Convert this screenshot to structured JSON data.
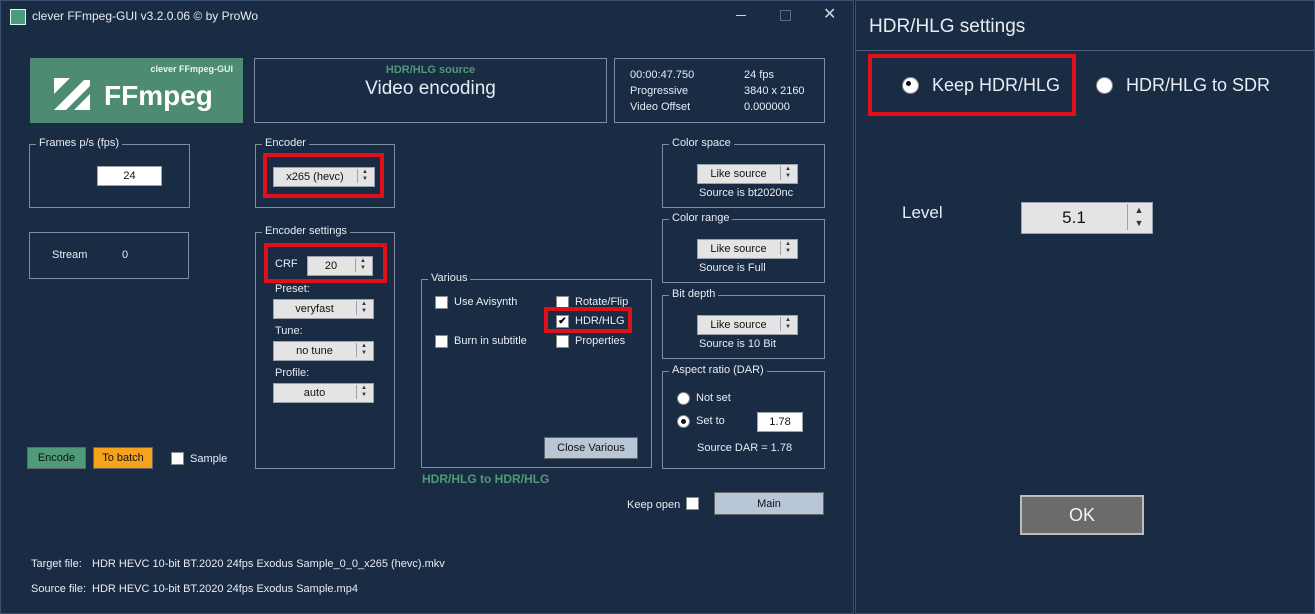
{
  "main_window": {
    "title": "clever FFmpeg-GUI v3.2.0.06   © by ProWo",
    "logo": {
      "small": "clever FFmpeg-GUI",
      "big": "FFmpeg"
    },
    "header": {
      "subtitle": "HDR/HLG source",
      "title": "Video encoding"
    },
    "info": {
      "duration": "00:00:47.750",
      "fps": "24 fps",
      "scan": "Progressive",
      "resolution": "3840 x 2160",
      "offset_label": "Video Offset",
      "offset_value": "0.000000"
    },
    "fps_box": {
      "legend": "Frames p/s (fps)",
      "value": "24"
    },
    "stream": {
      "label": "Stream",
      "value": "0"
    },
    "encoder": {
      "legend": "Encoder",
      "value": "x265 (hevc)"
    },
    "encoder_settings": {
      "legend": "Encoder settings",
      "crf_label": "CRF",
      "crf_value": "20",
      "preset_label": "Preset:",
      "preset_value": "veryfast",
      "tune_label": "Tune:",
      "tune_value": "no tune",
      "profile_label": "Profile:",
      "profile_value": "auto"
    },
    "various": {
      "legend": "Various",
      "use_avisynth": "Use Avisynth",
      "burn_subtitle": "Burn in subtitle",
      "rotate_flip": "Rotate/Flip",
      "hdr_hlg": "HDR/HLG",
      "properties": "Properties",
      "close_button": "Close Various"
    },
    "hdr_mode_text": "HDR/HLG to HDR/HLG",
    "color_space": {
      "legend": "Color space",
      "value": "Like source",
      "note": "Source is bt2020nc"
    },
    "color_range": {
      "legend": "Color range",
      "value": "Like source",
      "note": "Source is Full"
    },
    "bit_depth": {
      "legend": "Bit depth",
      "value": "Like source",
      "note": "Source is 10 Bit"
    },
    "aspect": {
      "legend": "Aspect ratio (DAR)",
      "not_set": "Not set",
      "set_to": "Set to",
      "value": "1.78",
      "source": "Source DAR = 1.78"
    },
    "buttons": {
      "encode": "Encode",
      "to_batch": "To batch",
      "sample": "Sample",
      "keep_open": "Keep open",
      "main": "Main"
    },
    "files": {
      "target_label": "Target file:",
      "target_value": "HDR HEVC 10-bit BT.2020 24fps  Exodus Sample_0_0_x265 (hevc).mkv",
      "source_label": "Source file:",
      "source_value": "HDR HEVC 10-bit BT.2020 24fps  Exodus Sample.mp4"
    },
    "colors": {
      "accent_green": "#4f9a78",
      "batch_orange": "#f7a21b",
      "highlight_red": "#e0101a"
    }
  },
  "hdr_dialog": {
    "title": "HDR/HLG settings",
    "keep": "Keep HDR/HLG",
    "to_sdr": "HDR/HLG to SDR",
    "level_label": "Level",
    "level_value": "5.1",
    "ok": "OK"
  }
}
